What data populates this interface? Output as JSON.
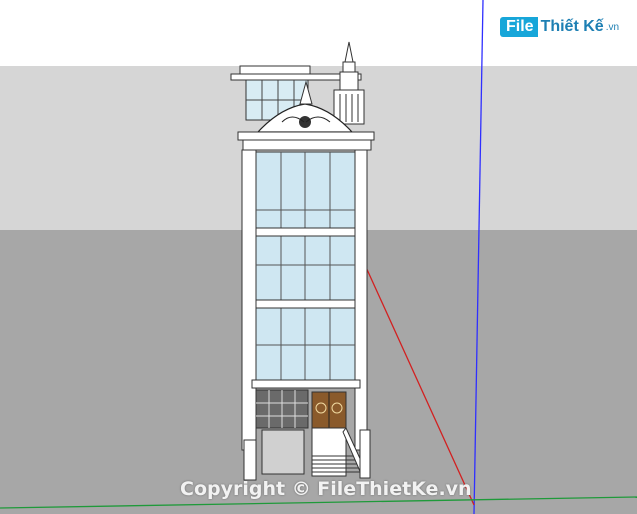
{
  "app": {
    "scene_type": "3D building model viewport",
    "colors": {
      "sky": "#ffffff",
      "horizon_band": "#d6d6d6",
      "ground": "#a7a7a7",
      "glass": "#cfe7f2",
      "axis_blue": "#2f2fff",
      "axis_red": "#d22020",
      "axis_green": "#1f9a3a"
    }
  },
  "branding": {
    "logo_file": "File",
    "logo_rest": "Thiết Kế",
    "logo_domain": ".vn",
    "watermark": "Copyright © FileThietKe.vn"
  }
}
